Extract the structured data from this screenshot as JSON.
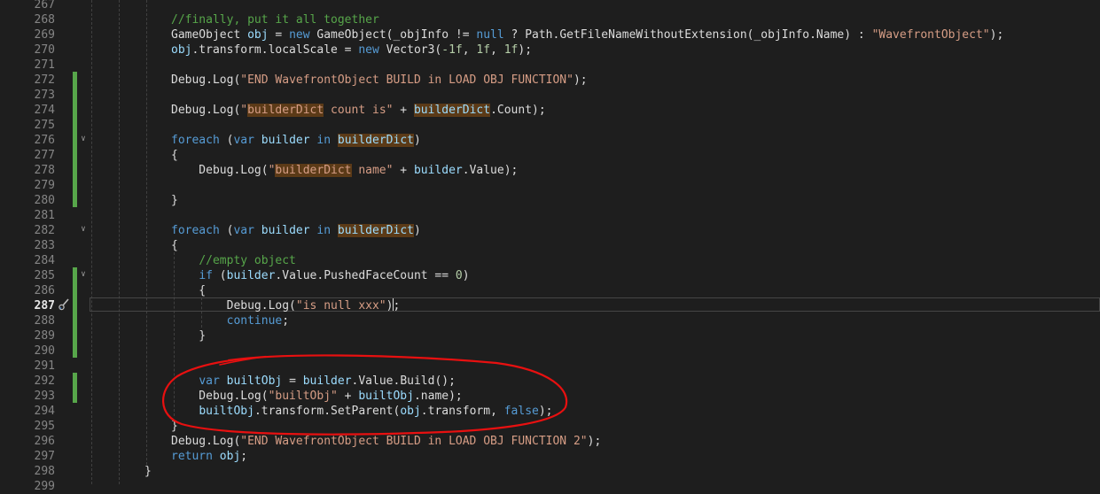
{
  "editor": {
    "active_line_number": "287",
    "lines": [
      {
        "n": "267",
        "tokens": []
      },
      {
        "n": "268",
        "tokens": [
          {
            "t": "//finally, put it all together",
            "c": "cm"
          }
        ]
      },
      {
        "n": "269",
        "tokens": [
          {
            "t": "GameObject ",
            "c": "pl"
          },
          {
            "t": "obj",
            "c": "var"
          },
          {
            "t": " = ",
            "c": "pl"
          },
          {
            "t": "new",
            "c": "kw"
          },
          {
            "t": " GameObject(",
            "c": "pl"
          },
          {
            "t": "_objInfo",
            "c": "pl"
          },
          {
            "t": " != ",
            "c": "pl"
          },
          {
            "t": "null",
            "c": "kw"
          },
          {
            "t": " ? Path.GetFileNameWithoutExtension(",
            "c": "pl"
          },
          {
            "t": "_objInfo",
            "c": "pl"
          },
          {
            "t": ".Name) : ",
            "c": "pl"
          },
          {
            "t": "\"WavefrontObject\"",
            "c": "str"
          },
          {
            "t": ");",
            "c": "pl"
          }
        ]
      },
      {
        "n": "270",
        "tokens": [
          {
            "t": "obj",
            "c": "var"
          },
          {
            "t": ".transform.localScale = ",
            "c": "pl"
          },
          {
            "t": "new",
            "c": "kw"
          },
          {
            "t": " Vector3(",
            "c": "pl"
          },
          {
            "t": "-1f",
            "c": "num"
          },
          {
            "t": ", ",
            "c": "pl"
          },
          {
            "t": "1f",
            "c": "num"
          },
          {
            "t": ", ",
            "c": "pl"
          },
          {
            "t": "1f",
            "c": "num"
          },
          {
            "t": ");",
            "c": "pl"
          }
        ]
      },
      {
        "n": "271",
        "tokens": []
      },
      {
        "n": "272",
        "tokens": [
          {
            "t": "Debug.Log(",
            "c": "pl"
          },
          {
            "t": "\"END WavefrontObject BUILD in LOAD OBJ FUNCTION\"",
            "c": "str"
          },
          {
            "t": ");",
            "c": "pl"
          }
        ]
      },
      {
        "n": "273",
        "tokens": []
      },
      {
        "n": "274",
        "tokens": [
          {
            "t": "Debug.Log(",
            "c": "pl"
          },
          {
            "t": "\"",
            "c": "str"
          },
          {
            "t": "builderDict",
            "c": "str hl"
          },
          {
            "t": " count is\"",
            "c": "str"
          },
          {
            "t": " + ",
            "c": "pl"
          },
          {
            "t": "builderDict",
            "c": "var hl"
          },
          {
            "t": ".Count);",
            "c": "pl"
          }
        ]
      },
      {
        "n": "275",
        "tokens": []
      },
      {
        "n": "276",
        "tokens": [
          {
            "t": "foreach",
            "c": "kw"
          },
          {
            "t": " (",
            "c": "pl"
          },
          {
            "t": "var",
            "c": "kw"
          },
          {
            "t": " ",
            "c": "pl"
          },
          {
            "t": "builder",
            "c": "var"
          },
          {
            "t": " ",
            "c": "pl"
          },
          {
            "t": "in",
            "c": "kw"
          },
          {
            "t": " ",
            "c": "pl"
          },
          {
            "t": "builderDict",
            "c": "var hl"
          },
          {
            "t": ")",
            "c": "pl"
          }
        ]
      },
      {
        "n": "277",
        "tokens": [
          {
            "t": "{",
            "c": "pl"
          }
        ]
      },
      {
        "n": "278",
        "tokens": [
          {
            "t": "    Debug.Log(",
            "c": "pl"
          },
          {
            "t": "\"",
            "c": "str"
          },
          {
            "t": "builderDict",
            "c": "str hl"
          },
          {
            "t": " name\"",
            "c": "str"
          },
          {
            "t": " + ",
            "c": "pl"
          },
          {
            "t": "builder",
            "c": "var"
          },
          {
            "t": ".Value);",
            "c": "pl"
          }
        ]
      },
      {
        "n": "279",
        "tokens": []
      },
      {
        "n": "280",
        "tokens": [
          {
            "t": "}",
            "c": "pl"
          }
        ]
      },
      {
        "n": "281",
        "tokens": []
      },
      {
        "n": "282",
        "tokens": [
          {
            "t": "foreach",
            "c": "kw"
          },
          {
            "t": " (",
            "c": "pl"
          },
          {
            "t": "var",
            "c": "kw"
          },
          {
            "t": " ",
            "c": "pl"
          },
          {
            "t": "builder",
            "c": "var"
          },
          {
            "t": " ",
            "c": "pl"
          },
          {
            "t": "in",
            "c": "kw"
          },
          {
            "t": " ",
            "c": "pl"
          },
          {
            "t": "builderDict",
            "c": "var hl"
          },
          {
            "t": ")",
            "c": "pl"
          }
        ]
      },
      {
        "n": "283",
        "tokens": [
          {
            "t": "{",
            "c": "pl"
          }
        ]
      },
      {
        "n": "284",
        "tokens": [
          {
            "t": "    ",
            "c": "pl"
          },
          {
            "t": "//empty object",
            "c": "cm"
          }
        ]
      },
      {
        "n": "285",
        "tokens": [
          {
            "t": "    ",
            "c": "pl"
          },
          {
            "t": "if",
            "c": "kw"
          },
          {
            "t": " (",
            "c": "pl"
          },
          {
            "t": "builder",
            "c": "var"
          },
          {
            "t": ".Value.PushedFaceCount == ",
            "c": "pl"
          },
          {
            "t": "0",
            "c": "num"
          },
          {
            "t": ")",
            "c": "pl"
          }
        ]
      },
      {
        "n": "286",
        "tokens": [
          {
            "t": "    {",
            "c": "pl"
          }
        ]
      },
      {
        "n": "287",
        "tokens": [
          {
            "t": "        Debug.Log(",
            "c": "pl"
          },
          {
            "t": "\"is null xxx\"",
            "c": "str"
          },
          {
            "t": ");",
            "c": "pl"
          }
        ]
      },
      {
        "n": "288",
        "tokens": [
          {
            "t": "        ",
            "c": "pl"
          },
          {
            "t": "continue",
            "c": "kw"
          },
          {
            "t": ";",
            "c": "pl"
          }
        ]
      },
      {
        "n": "289",
        "tokens": [
          {
            "t": "    }",
            "c": "pl"
          }
        ]
      },
      {
        "n": "290",
        "tokens": []
      },
      {
        "n": "291",
        "tokens": []
      },
      {
        "n": "292",
        "tokens": [
          {
            "t": "    ",
            "c": "pl"
          },
          {
            "t": "var",
            "c": "kw"
          },
          {
            "t": " ",
            "c": "pl"
          },
          {
            "t": "builtObj",
            "c": "var"
          },
          {
            "t": " = ",
            "c": "pl"
          },
          {
            "t": "builder",
            "c": "var"
          },
          {
            "t": ".Value.Build();",
            "c": "pl"
          }
        ]
      },
      {
        "n": "293",
        "tokens": [
          {
            "t": "    Debug.Log(",
            "c": "pl"
          },
          {
            "t": "\"builtObj\"",
            "c": "str"
          },
          {
            "t": " + ",
            "c": "pl"
          },
          {
            "t": "builtObj",
            "c": "var"
          },
          {
            "t": ".name);",
            "c": "pl"
          }
        ]
      },
      {
        "n": "294",
        "tokens": [
          {
            "t": "    ",
            "c": "pl"
          },
          {
            "t": "builtObj",
            "c": "var"
          },
          {
            "t": ".transform.SetParent(",
            "c": "pl"
          },
          {
            "t": "obj",
            "c": "var"
          },
          {
            "t": ".transform, ",
            "c": "pl"
          },
          {
            "t": "false",
            "c": "kw"
          },
          {
            "t": ");",
            "c": "pl"
          }
        ]
      },
      {
        "n": "295",
        "tokens": [
          {
            "t": "}",
            "c": "pl"
          }
        ]
      },
      {
        "n": "296",
        "tokens": [
          {
            "t": "Debug.Log(",
            "c": "pl"
          },
          {
            "t": "\"END WavefrontObject BUILD in LOAD OBJ FUNCTION 2\"",
            "c": "str"
          },
          {
            "t": ");",
            "c": "pl"
          }
        ]
      },
      {
        "n": "297",
        "tokens": [
          {
            "t": "return",
            "c": "kw"
          },
          {
            "t": " ",
            "c": "pl"
          },
          {
            "t": "obj",
            "c": "var"
          },
          {
            "t": ";",
            "c": "pl"
          }
        ]
      },
      {
        "n": "298",
        "tokens": [
          {
            "t": "}",
            "c": "pl"
          }
        ]
      },
      {
        "n": "299",
        "tokens": []
      }
    ]
  },
  "icons": {
    "fold_toggle": "chevron-down-icon",
    "edit_brush": "paintbrush-icon"
  },
  "colors": {
    "background": "#1e1e1e",
    "change_bar": "#57a64a",
    "annotation_circle": "#e81010"
  }
}
